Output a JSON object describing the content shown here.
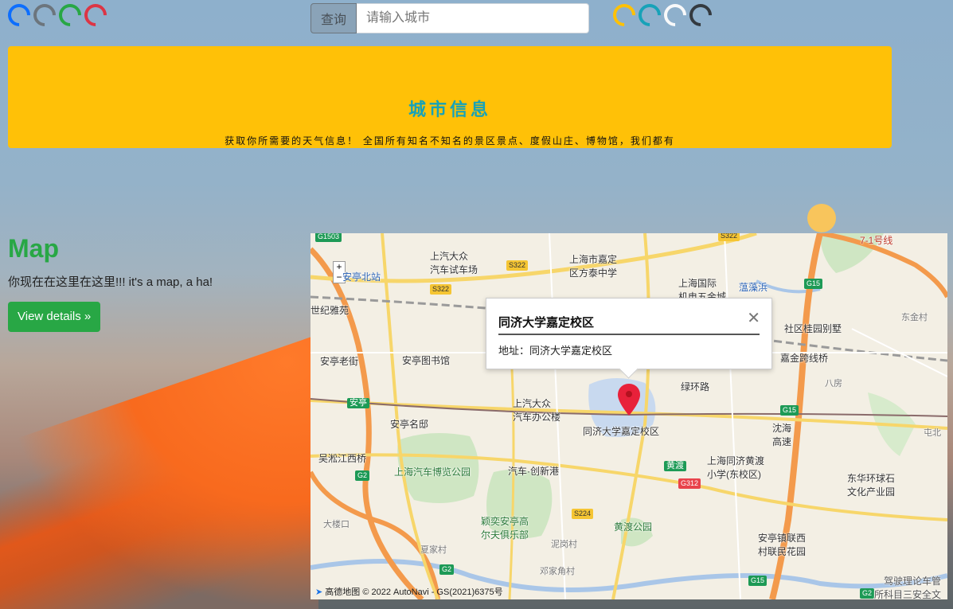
{
  "header": {
    "search_button": "查询",
    "search_placeholder": "请输入城市",
    "spinners_left": [
      "#0d6efd",
      "#6c757d",
      "#28a745",
      "#dc3545"
    ],
    "spinners_right": [
      "#ffc107",
      "#17a2b8",
      "#f8f9fa",
      "#343a40"
    ]
  },
  "jumbotron": {
    "title": "城市信息",
    "subtitle": "获取你所需要的天气信息！ 全国所有知名不知名的景区景点、度假山庄、博物馆，我们都有"
  },
  "map_section": {
    "heading": "Map",
    "description": "你现在在这里在这里!!! it's a map, a ha!",
    "button": "View details »"
  },
  "map": {
    "popup_title": "同济大学嘉定校区",
    "popup_address": "地址：同济大学嘉定校区",
    "zoom_in": "+",
    "zoom_out": "−",
    "footer": "高德地图 © 2022 AutoNavi - GS(2021)6375号",
    "pois": [
      {
        "name": "上汽大众汽车试车场",
        "line1": "上汽大众",
        "line2": "汽车试车场"
      },
      {
        "name": "上海市嘉定区方泰中学",
        "line1": "上海市嘉定",
        "line2": "区方泰中学"
      },
      {
        "name": "上海国际机电五金城",
        "line1": "上海国际",
        "line2": "机电五金城"
      },
      {
        "name": "蕰藻浜",
        "line1": "蕰藻浜"
      },
      {
        "name": "安亭北站",
        "line1": "安亭北站"
      },
      {
        "name": "世纪雅苑",
        "line1": "世纪雅苑"
      },
      {
        "name": "安亭老街",
        "line1": "安亭老街"
      },
      {
        "name": "安亭图书馆",
        "line1": "安亭图书馆"
      },
      {
        "name": "安亭",
        "line1": "安亭"
      },
      {
        "name": "安亭名邸",
        "line1": "安亭名邸"
      },
      {
        "name": "上汽大众汽车办公楼",
        "line1": "上汽大众",
        "line2": "汽车办公楼"
      },
      {
        "name": "同济大学嘉定校区",
        "line1": "同济大学嘉定校区"
      },
      {
        "name": "绿环路",
        "line1": "绿环路"
      },
      {
        "name": "嘉金跨线桥",
        "line1": "嘉金跨线桥"
      },
      {
        "name": "社区桂园别墅",
        "line1": "社区桂园别墅"
      },
      {
        "name": "吴淞江西桥",
        "line1": "吴淞江西桥"
      },
      {
        "name": "上海汽车博览公园",
        "line1": "上海汽车博览公园"
      },
      {
        "name": "汽车·创新港",
        "line1": "汽车·创新港"
      },
      {
        "name": "颖奕安亭高尔夫俱乐部",
        "line1": "颖奕安亭高",
        "line2": "尔夫俱乐部"
      },
      {
        "name": "黄渡公园",
        "line1": "黄渡公园"
      },
      {
        "name": "黄渡",
        "line1": "黄渡"
      },
      {
        "name": "上海同济黄渡小学(东校区)",
        "line1": "上海同济黄渡",
        "line2": "小学(东校区)"
      },
      {
        "name": "沈海高速",
        "line1": "沈海",
        "line2": "高速"
      },
      {
        "name": "东华环球石文化产业园",
        "line1": "东华环球石",
        "line2": "文化产业园"
      },
      {
        "name": "安亭镇联西村联民花园",
        "line1": "安亭镇联西",
        "line2": "村联民花园"
      },
      {
        "name": "大楼口",
        "line1": "大楼口"
      },
      {
        "name": "夏家村",
        "line1": "夏家村"
      },
      {
        "name": "泥岗村",
        "line1": "泥岗村"
      },
      {
        "name": "邓家角村",
        "line1": "邓家角村"
      },
      {
        "name": "东金村",
        "line1": "东金村"
      },
      {
        "name": "八房",
        "line1": "八房"
      },
      {
        "name": "屯北",
        "line1": "屯北"
      },
      {
        "name": "驾驶理论车管所科目三安全文",
        "line1": "驾驶理论车管",
        "line2": "所科目三安全文"
      }
    ],
    "road_tags": [
      "G1503",
      "S322",
      "S322",
      "S322",
      "G15",
      "G15",
      "G15",
      "G2",
      "G2",
      "G2",
      "G312",
      "S224",
      "7-1号线"
    ]
  }
}
